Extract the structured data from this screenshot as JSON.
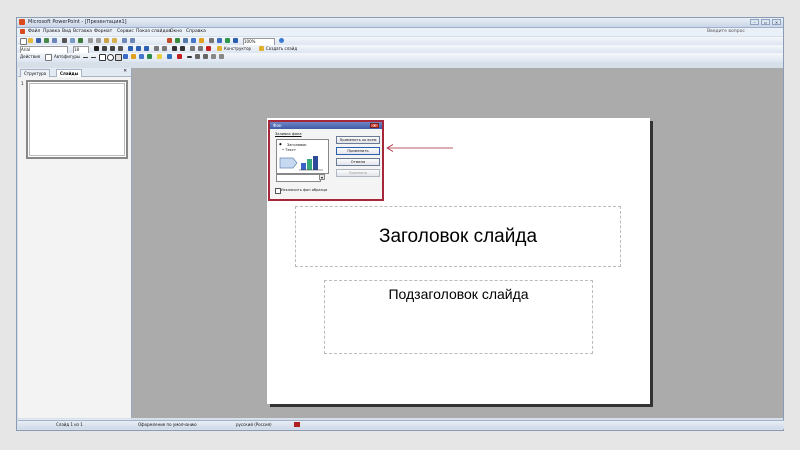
{
  "window": {
    "title": "Microsoft PowerPoint - [Презентация1]",
    "buttons": [
      "–",
      "▫",
      "✕"
    ]
  },
  "menu": {
    "items": [
      "Файл",
      "Правка",
      "Вид",
      "Вставка",
      "Формат",
      "Сервис",
      "Показ слайдов",
      "Окно",
      "Справка"
    ],
    "help_placeholder": "Введите вопрос"
  },
  "toolbar": {
    "zoom": "100%",
    "font_name": "Arial",
    "font_size": "18",
    "constructor_label": "Конструктор",
    "new_slide_label": "Создать слайд",
    "actions_label": "Действия",
    "autoshapes_label": "Автофигуры"
  },
  "panel": {
    "tabs": [
      "Структура",
      "Слайды"
    ],
    "active_tab": "Слайды",
    "close": "✕",
    "slide_number": "1"
  },
  "slide": {
    "title": "Заголовок слайда",
    "subtitle": "Подзаголовок слайда"
  },
  "dialog": {
    "title": "Фон",
    "close": "✕",
    "section_label": "Заливка фона",
    "legend_title": "Заголовок",
    "legend_text": "• Текст",
    "apply_all": "Применить ко всем",
    "apply": "Применить",
    "cancel": "Отмена",
    "preview": "Просмотр",
    "checkbox_label": "Исключить фон образца"
  },
  "status": {
    "slide_info": "Слайд 1 из 1",
    "design": "Оформление по умолчанию",
    "language": "русский (Россия)"
  },
  "colors": {
    "highlight": "#a6263a",
    "dialog_title": "#3e5aa8",
    "workspace": "#ababab"
  }
}
